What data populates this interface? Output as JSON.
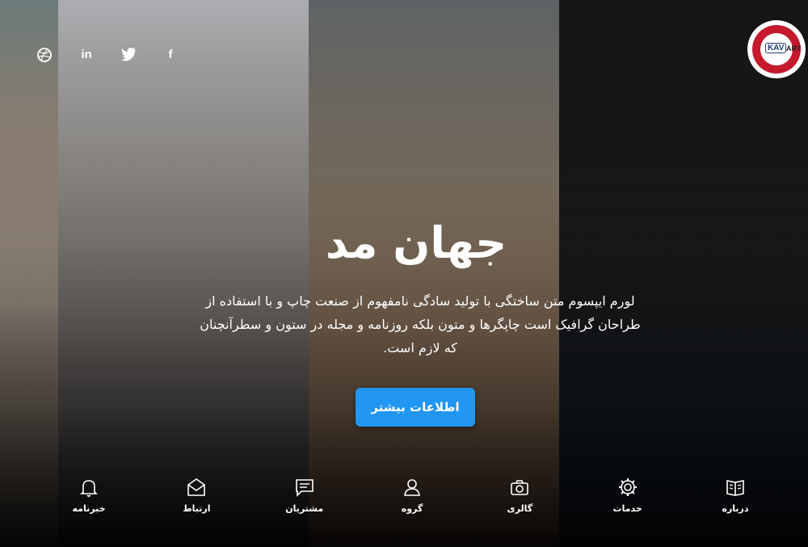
{
  "social_icons": [
    "dribbble-icon",
    "linkedin-icon",
    "twitter-icon",
    "facebook-icon"
  ],
  "social_glyphs": {
    "linkedin": "in",
    "facebook": "f"
  },
  "logo": {
    "mark": "KAV",
    "sub": "ART"
  },
  "hero": {
    "title": "جهان مد",
    "description": "لورم ایپسوم متن ساختگی با تولید سادگی نامفهوم از صنعت چاپ و با استفاده از طراحان گرافیک است چاپگرها و متون بلکه روزنامه و مجله در ستون و سطرآنچنان که لازم است.",
    "cta_label": "اطلاعات بیشتر"
  },
  "nav": {
    "items": [
      {
        "label": "درباره",
        "icon": "book-icon"
      },
      {
        "label": "خدمات",
        "icon": "gear-icon"
      },
      {
        "label": "گالری",
        "icon": "camera-icon"
      },
      {
        "label": "گروه",
        "icon": "users-icon"
      },
      {
        "label": "مشتریان",
        "icon": "chat-icon"
      },
      {
        "label": "ارتباط",
        "icon": "mail-icon"
      },
      {
        "label": "خبرنامه",
        "icon": "bell-icon"
      }
    ]
  },
  "colors": {
    "cta": "#2196f3",
    "logo_ring": "#c5192d",
    "logo_text": "#1f3f73"
  }
}
